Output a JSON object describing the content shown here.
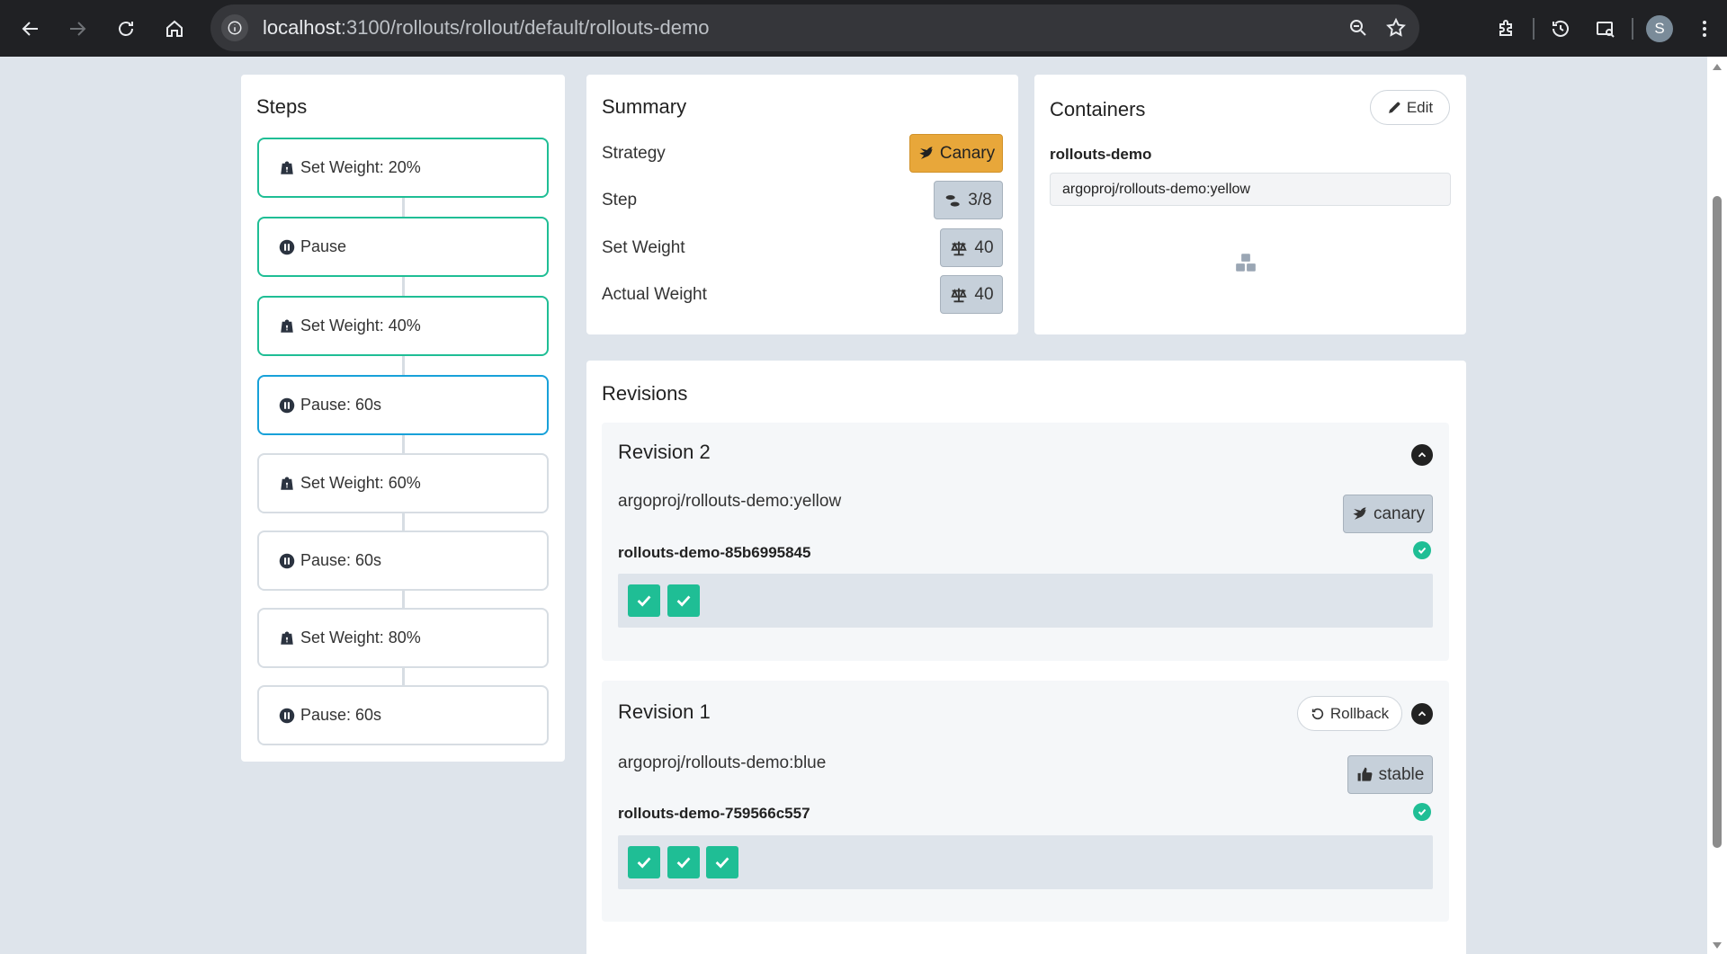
{
  "browser": {
    "url_host": "localhost",
    "url_path": ":3100/rollouts/rollout/default/rollouts-demo",
    "profile_initial": "S"
  },
  "steps": {
    "title": "Steps",
    "items": [
      {
        "label": "Set Weight: 20%",
        "kind": "weight",
        "state": "done"
      },
      {
        "label": "Pause",
        "kind": "pause",
        "state": "done"
      },
      {
        "label": "Set Weight: 40%",
        "kind": "weight",
        "state": "done"
      },
      {
        "label": "Pause: 60s",
        "kind": "pause",
        "state": "current"
      },
      {
        "label": "Set Weight: 60%",
        "kind": "weight",
        "state": "pending"
      },
      {
        "label": "Pause: 60s",
        "kind": "pause",
        "state": "pending"
      },
      {
        "label": "Set Weight: 80%",
        "kind": "weight",
        "state": "pending"
      },
      {
        "label": "Pause: 60s",
        "kind": "pause",
        "state": "pending"
      }
    ]
  },
  "summary": {
    "title": "Summary",
    "strategy_label": "Strategy",
    "strategy_value": "Canary",
    "step_label": "Step",
    "step_value": "3/8",
    "set_weight_label": "Set Weight",
    "set_weight_value": "40",
    "actual_weight_label": "Actual Weight",
    "actual_weight_value": "40"
  },
  "containers": {
    "title": "Containers",
    "edit_label": "Edit",
    "name": "rollouts-demo",
    "image": "argoproj/rollouts-demo:yellow"
  },
  "revisions": {
    "title": "Revisions",
    "items": [
      {
        "title": "Revision 2",
        "image": "argoproj/rollouts-demo:yellow",
        "badge": "canary",
        "replicaset": "rollouts-demo-85b6995845",
        "pods": 2
      },
      {
        "title": "Revision 1",
        "image": "argoproj/rollouts-demo:blue",
        "badge": "stable",
        "rollback_label": "Rollback",
        "replicaset": "rollouts-demo-759566c557",
        "pods": 3
      }
    ]
  },
  "colors": {
    "done_border": "#1fbe95",
    "current_border": "#18a1d9",
    "canary_badge": "#e8a73a",
    "pod_healthy": "#1fbe95"
  }
}
